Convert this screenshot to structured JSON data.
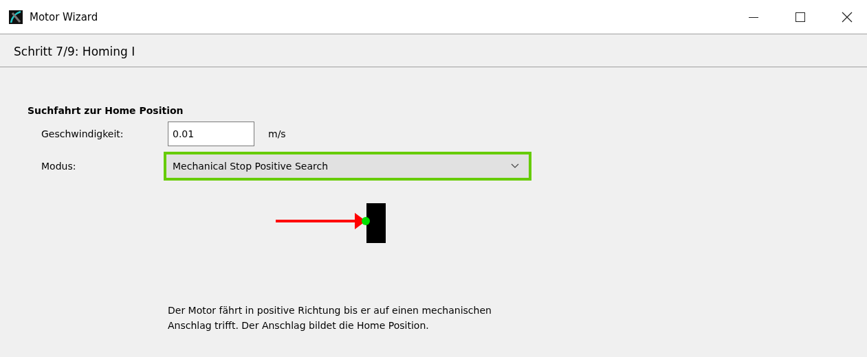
{
  "window": {
    "title": "Motor Wizard"
  },
  "step_header": {
    "title": "Schritt 7/9: Homing I"
  },
  "section": {
    "title": "Suchfahrt zur Home Position"
  },
  "speed": {
    "label": "Geschwindigkeit:",
    "value": "0.01",
    "unit": "m/s"
  },
  "mode": {
    "label": "Modus:",
    "value": "Mechanical Stop Positive Search",
    "highlighted": true
  },
  "description": "Der Motor fährt in positive Richtung bis er auf einen mechanischen Anschlag trifft. Der Anschlag bildet die Home Position."
}
